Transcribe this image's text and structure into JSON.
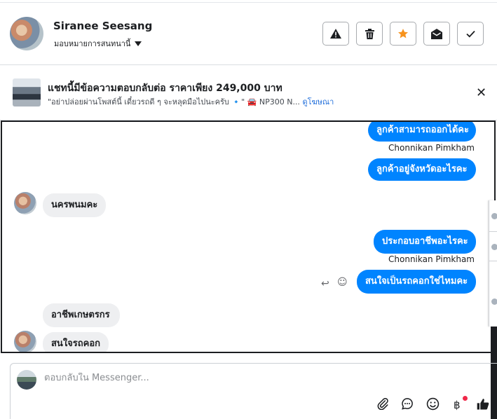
{
  "header": {
    "name": "Siranee Seesang",
    "assign_label": "มอบหมายการสนทนานี้",
    "toolbar": {
      "report_icon": "warning-icon",
      "delete_icon": "trash-icon",
      "star_icon": "star-icon",
      "unread_icon": "envelope-open-icon",
      "done_icon": "checkmark-icon",
      "star_color": "#f7931e"
    }
  },
  "ad": {
    "title": "แชทนี้มีข้อความตอบกลับต่อ ราคาเพียง 249,000 บาท",
    "subtitle": "\"อย่าปล่อยผ่านโพสต์นี้ เดี๋ยวรถดี ๆ จะหลุดมือไปนะครับ 🔹\" 🚘 NP300 N...",
    "link": "ดูโฆษณา",
    "close": "✕"
  },
  "messages": [
    {
      "dir": "out",
      "text": "ลูกค้าสามารถออกได้คะ"
    },
    {
      "dir": "sender",
      "text": "Chonnikan Pimkham"
    },
    {
      "dir": "out",
      "text": "ลูกค้าอยู่จังหวัดอะไรคะ"
    },
    {
      "dir": "in",
      "text": "นครพนมคะ"
    },
    {
      "dir": "out",
      "text": "ประกอบอาชีพอะไรคะ"
    },
    {
      "dir": "sender",
      "text": "Chonnikan Pimkham"
    },
    {
      "dir": "out",
      "text": "สนใจเป็นรถคอกใช่ไหมคะ"
    },
    {
      "dir": "in",
      "text": "อาชีพเกษตรกร"
    },
    {
      "dir": "in",
      "text": "สนใจรถคอก"
    }
  ],
  "reply": {
    "placeholder": "ตอบกลับใน Messenger...",
    "icons": [
      "paperclip-icon",
      "chat-icon",
      "emoji-icon",
      "baht-icon",
      "thumbs-up-icon"
    ],
    "baht_glyph": "฿",
    "accent": "#0084ff"
  }
}
